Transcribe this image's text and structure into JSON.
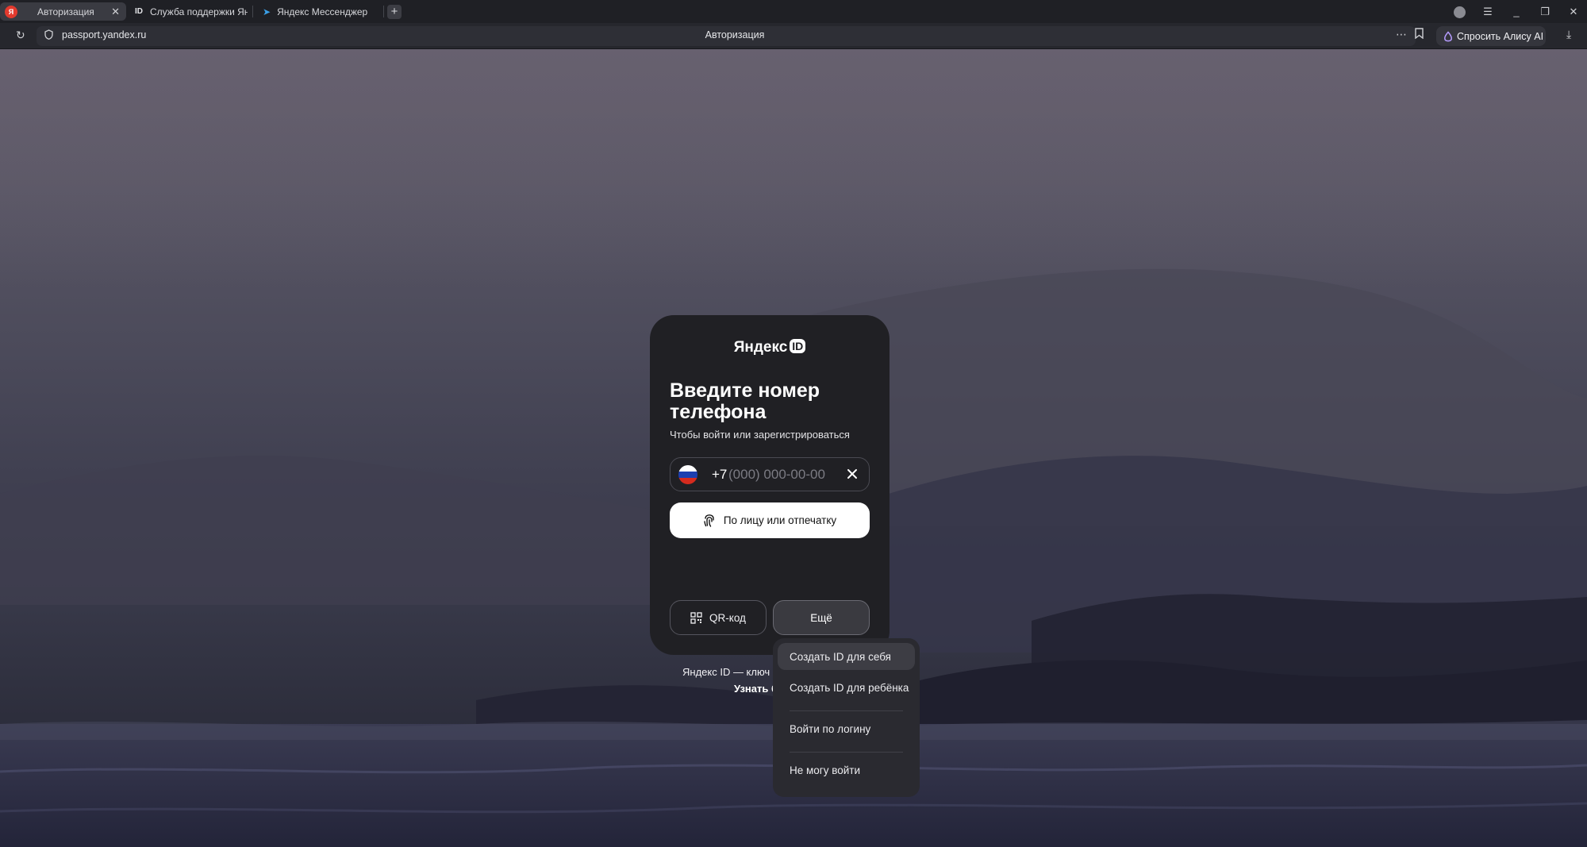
{
  "browser": {
    "tabs": [
      {
        "label": "Авторизация",
        "active": true
      },
      {
        "label": "Служба поддержки Яндекс",
        "active": false
      },
      {
        "label": "Яндекс Мессенджер",
        "active": false
      }
    ],
    "address": "passport.yandex.ru",
    "page_title": "Авторизация",
    "alice_button": "Спросить Алису AI"
  },
  "login": {
    "brand": "Яндекс",
    "brand_badge": "ID",
    "heading": "Введите номер телефона",
    "subheading": "Чтобы войти или зарегистрироваться",
    "phone": {
      "country_code": "+7",
      "placeholder": "(000) 000-00-00",
      "value": ""
    },
    "biometric_button": "По лицу или отпечатку",
    "qr_button": "QR-код",
    "more_button": "Ещё"
  },
  "footer": {
    "line1": "Яндекс ID — ключ д",
    "line2": "Узнать б"
  },
  "more_menu": {
    "items": [
      {
        "label": "Создать ID для себя",
        "hovered": true
      },
      {
        "label": "Создать ID для ребёнка",
        "hovered": false
      },
      {
        "label": "Войти по логину",
        "hovered": false
      },
      {
        "label": "Не могу войти",
        "hovered": false
      }
    ]
  },
  "colors": {
    "card_bg": "#202024",
    "primary_button_bg": "#ffffff",
    "flag_white": "#ffffff",
    "flag_blue": "#1c3fb0",
    "flag_red": "#d52b1e"
  }
}
